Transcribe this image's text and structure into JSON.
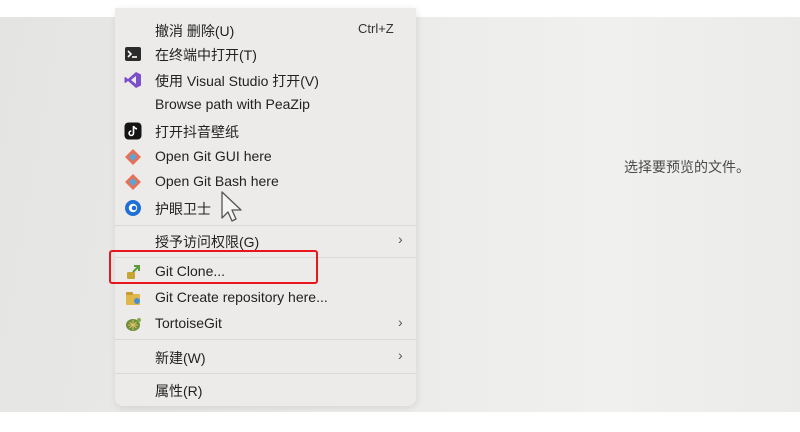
{
  "context_menu": {
    "items": [
      {
        "label": "撤消 删除(U)",
        "shortcut": "Ctrl+Z",
        "icon": "none"
      },
      {
        "label": "在终端中打开(T)",
        "icon": "terminal-icon"
      },
      {
        "label": "使用 Visual Studio 打开(V)",
        "icon": "visual-studio-icon"
      },
      {
        "label": "Browse path with PeaZip",
        "icon": "none"
      },
      {
        "label": "打开抖音壁纸",
        "icon": "douyin-icon"
      },
      {
        "label": "Open Git GUI here",
        "icon": "git-gui-icon"
      },
      {
        "label": "Open Git Bash here",
        "icon": "git-bash-icon"
      },
      {
        "label": "护眼卫士",
        "icon": "eye-guard-icon"
      },
      {
        "label": "授予访问权限(G)",
        "submenu": true
      },
      {
        "label": "Git Clone...",
        "icon": "tortoisegit-clone-icon",
        "highlighted": true
      },
      {
        "label": "Git Create repository here...",
        "icon": "tortoisegit-create-repo-icon"
      },
      {
        "label": "TortoiseGit",
        "icon": "tortoisegit-icon",
        "submenu": true
      },
      {
        "label": "新建(W)",
        "submenu": true
      },
      {
        "label": "属性(R)"
      }
    ],
    "submenu_glyph": "›"
  },
  "preview": {
    "message": "选择要预览的文件。"
  },
  "colors": {
    "highlight_border": "#e8161d",
    "menu_background": "#ecebe9"
  }
}
